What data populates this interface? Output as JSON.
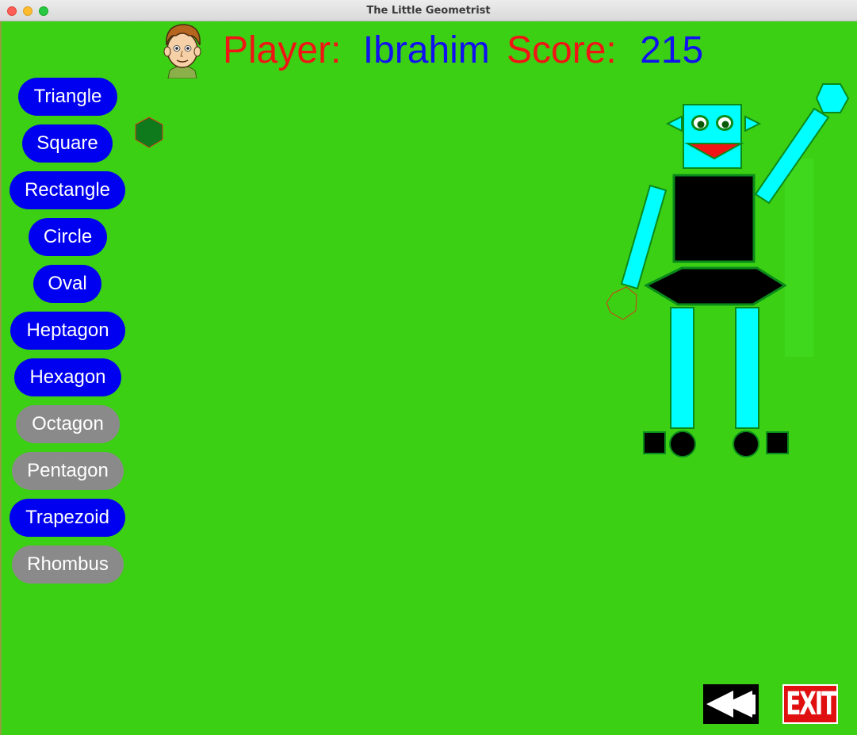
{
  "window": {
    "title": "The Little Geometrist"
  },
  "header": {
    "player_label": "Player:",
    "player_name": "Ibrahim",
    "score_label": "Score:",
    "score_value": "215"
  },
  "shape_buttons": [
    {
      "label": "Triangle",
      "enabled": true
    },
    {
      "label": "Square",
      "enabled": true
    },
    {
      "label": "Rectangle",
      "enabled": true
    },
    {
      "label": "Circle",
      "enabled": true
    },
    {
      "label": "Oval",
      "enabled": true
    },
    {
      "label": "Heptagon",
      "enabled": true
    },
    {
      "label": "Hexagon",
      "enabled": true
    },
    {
      "label": "Octagon",
      "enabled": false
    },
    {
      "label": "Pentagon",
      "enabled": false
    },
    {
      "label": "Trapezoid",
      "enabled": true
    },
    {
      "label": "Rhombus",
      "enabled": false
    }
  ],
  "controls": {
    "exit_label": "EXIT",
    "back_icon": "rewind-icon"
  },
  "colors": {
    "background": "#3cd014",
    "label_red": "#f01414",
    "value_blue": "#1010f0",
    "button_enabled": "#0000f0",
    "button_disabled": "#8a8a8a",
    "robot_cyan": "#00ffff",
    "robot_black": "#000000",
    "dragged_hexagon": "#0e7a1c"
  }
}
